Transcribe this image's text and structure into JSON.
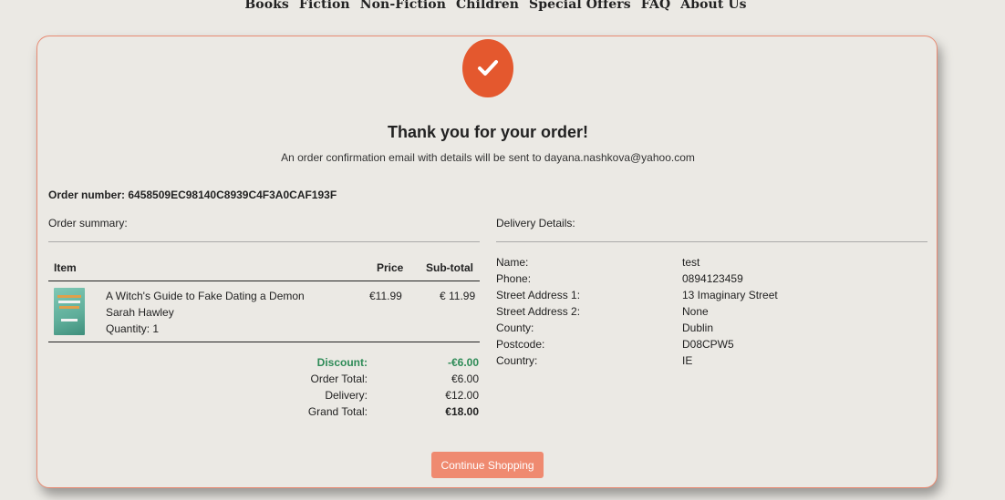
{
  "nav": {
    "items": [
      "Books",
      "Fiction",
      "Non-Fiction",
      "Children",
      "Special Offers",
      "FAQ",
      "About Us"
    ]
  },
  "confirmation": {
    "title": "Thank you for your order!",
    "subtitle": "An order confirmation email with details will be sent to dayana.nashkova@yahoo.com",
    "order_number_label": "Order number: 6458509EC98140C8939C4F3A0CAF193F"
  },
  "summary": {
    "label": "Order summary:",
    "columns": {
      "item": "Item",
      "price": "Price",
      "subtotal": "Sub-total"
    },
    "items": [
      {
        "title": "A Witch's Guide to Fake Dating a Demon",
        "author": "Sarah Hawley",
        "quantity": "Quantity: 1",
        "price": "€11.99",
        "subtotal": "€ 11.99"
      }
    ],
    "totals": {
      "discount_label": "Discount:",
      "discount_value": "-€6.00",
      "order_total_label": "Order Total:",
      "order_total_value": "€6.00",
      "delivery_label": "Delivery:",
      "delivery_value": "€12.00",
      "grand_total_label": "Grand Total:",
      "grand_total_value": "€18.00"
    }
  },
  "delivery": {
    "label": "Delivery Details:",
    "fields": [
      {
        "label": "Name:",
        "value": "test"
      },
      {
        "label": "Phone:",
        "value": "0894123459"
      },
      {
        "label": "Street Address 1:",
        "value": "13 Imaginary Street"
      },
      {
        "label": "Street Address 2:",
        "value": "None"
      },
      {
        "label": "County:",
        "value": "Dublin"
      },
      {
        "label": "Postcode:",
        "value": "D08CPW5"
      },
      {
        "label": "Country:",
        "value": "IE"
      }
    ]
  },
  "actions": {
    "continue_label": "Continue Shopping"
  },
  "colors": {
    "accent": "#e4582e",
    "button": "#ef8a70",
    "discount": "#2e8b57",
    "background": "#ebe9e4"
  }
}
